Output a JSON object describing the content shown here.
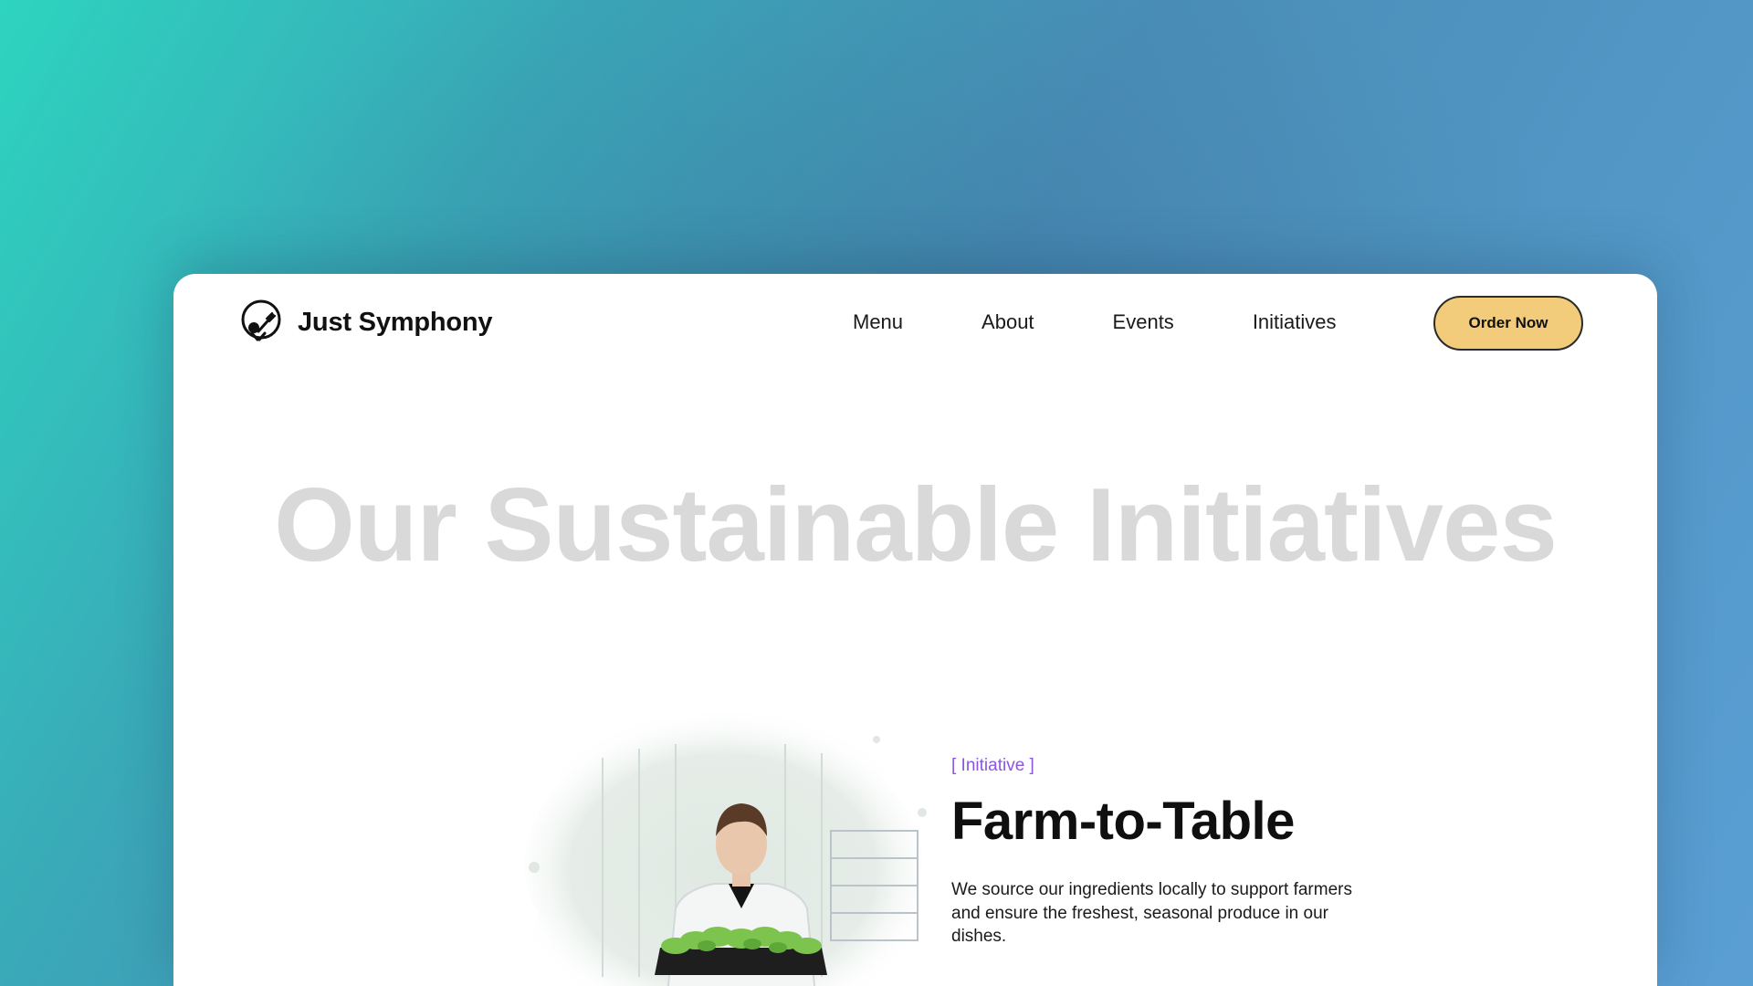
{
  "brand": {
    "name": "Just Symphony",
    "logo_icon": "fork-spoon-plate-icon"
  },
  "nav": {
    "links": [
      "Menu",
      "About",
      "Events",
      "Initiatives"
    ],
    "cta_label": "Order Now"
  },
  "hero": {
    "title": "Our Sustainable Initiatives"
  },
  "feature": {
    "tag": "[ Initiative ]",
    "title": "Farm-to-Table",
    "description": "We source our ingredients locally to support farmers and ensure the freshest, seasonal produce in our dishes.",
    "image_icon": "farmer-with-seedlings-photo"
  },
  "colors": {
    "accent": "#f2cc7a",
    "tag": "#8a56e2",
    "hero_title": "#d9d9d9",
    "background_start": "#2dd4bf",
    "background_end": "#5a9fd4"
  }
}
